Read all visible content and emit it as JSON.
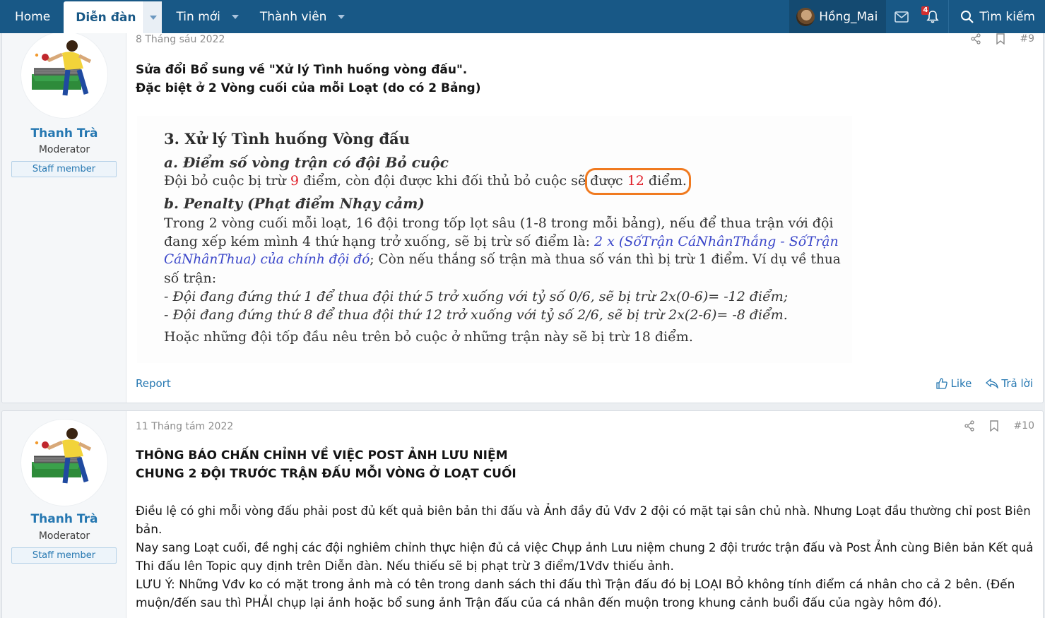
{
  "nav": {
    "home": "Home",
    "forums": "Diễn đàn",
    "whats_new": "Tin mới",
    "members": "Thành viên",
    "username": "Hồng_Mai",
    "alert_count": "4",
    "search": "Tìm kiếm"
  },
  "posts": [
    {
      "date": "8 Tháng sáu 2022",
      "number": "#9",
      "author": "Thanh Trà",
      "role": "Moderator",
      "badge": "Staff member",
      "heading_1": "Sửa đổi Bổ sung về \"Xử lý Tình huống vòng đấu\".",
      "heading_2": "Đặc biệt ở 2 Vòng cuối của mỗi Loạt (do có 2 Bảng)",
      "image": {
        "title": "3. Xử lý Tình huống Vòng đấu",
        "sub_a": "a. Điểm số vòng trận có đội Bỏ cuộc",
        "line_a_1": "Đội bỏ cuộc bị trừ ",
        "line_a_num1": "9",
        "line_a_2": " điểm, còn đội được khi đối thủ bỏ cuộc sẽ được ",
        "line_a_num2": "12",
        "line_a_3": " điểm.",
        "sub_b": "b. Penalty (Phạt điểm Nhạy cảm)",
        "line_b_1": "Trong 2 vòng cuối mỗi loạt, 16 đội trong tốp lọt sâu (1-8 trong mỗi bảng), nếu để thua trận với đội",
        "line_b_2a": "đang xếp kém mình 4 thứ hạng trở xuống, sẽ bị trừ số điểm là: ",
        "line_b_2b": "2 x (SốTrận CáNhânThắng - SốTrận",
        "line_b_3a": "CáNhânThua) của chính đội đó",
        "line_b_3b": "; Còn nếu thắng số trận mà thua số ván thì bị trừ 1 điểm. Ví dụ về thua",
        "line_b_4": "số trận:",
        "line_b_5": "- Đội đang đứng thứ 1 để thua đội thứ 5 trở xuống với tỷ số 0/6, sẽ bị trừ 2x(0-6)= -12 điểm;",
        "line_b_6": "- Đội đang đứng thứ 8 để thua đội thứ 12 trở xuống với tỷ số 2/6, sẽ bị trừ 2x(2-6)= -8 điểm.",
        "line_b_7": "Hoặc những đội tốp đầu nêu trên bỏ cuộc ở những trận này sẽ bị trừ 18 điểm."
      },
      "report": "Report",
      "like": "Like",
      "reply": "Trả lời"
    },
    {
      "date": "11 Tháng tám 2022",
      "number": "#10",
      "author": "Thanh Trà",
      "role": "Moderator",
      "badge": "Staff member",
      "heading_1": "THÔNG BÁO CHẤN CHỈNH VỀ VIỆC POST ẢNH LƯU NIỆM",
      "heading_2": "CHUNG 2 ĐỘI TRƯỚC TRẬN ĐẤU MỖI VÒNG Ở LOẠT CUỐI",
      "para_1a": "Điều lệ có ghi mỗi vòng đấu phải post đủ kết quả biên bản thi đấu và Ảnh đầy đủ Vđv 2 đội có mặt tại sân chủ nhà. Nhưng Loạt đầu thường chỉ post Biên",
      "para_1b": "bản.",
      "para_2a": "Nay sang Loạt cuối, đề nghị các đội nghiêm chỉnh thực hiện đủ cả việc Chụp ảnh Lưu niệm chung 2 đội trước trận đấu và Post Ảnh cùng Biên bản Kết quả",
      "para_2b": "Thi đấu lên Topic quy định trên Diễn đàn. Nếu thiếu sẽ bị phạt trừ 3 điểm/1Vđv thiếu ảnh.",
      "para_3a": "LƯU Ý: Những Vđv ko có mặt trong ảnh mà có tên trong danh sách thi đấu thì Trận đấu đó bị LOẠI BỎ không tính điểm cá nhân cho cả 2 bên. (Đến",
      "para_3b": "muộn/đến sau thì PHẢI chụp lại ảnh hoặc bổ sung ảnh Trận đấu của cá nhân đến muộn trong khung cảnh buổi đấu của ngày hôm đó)."
    }
  ]
}
